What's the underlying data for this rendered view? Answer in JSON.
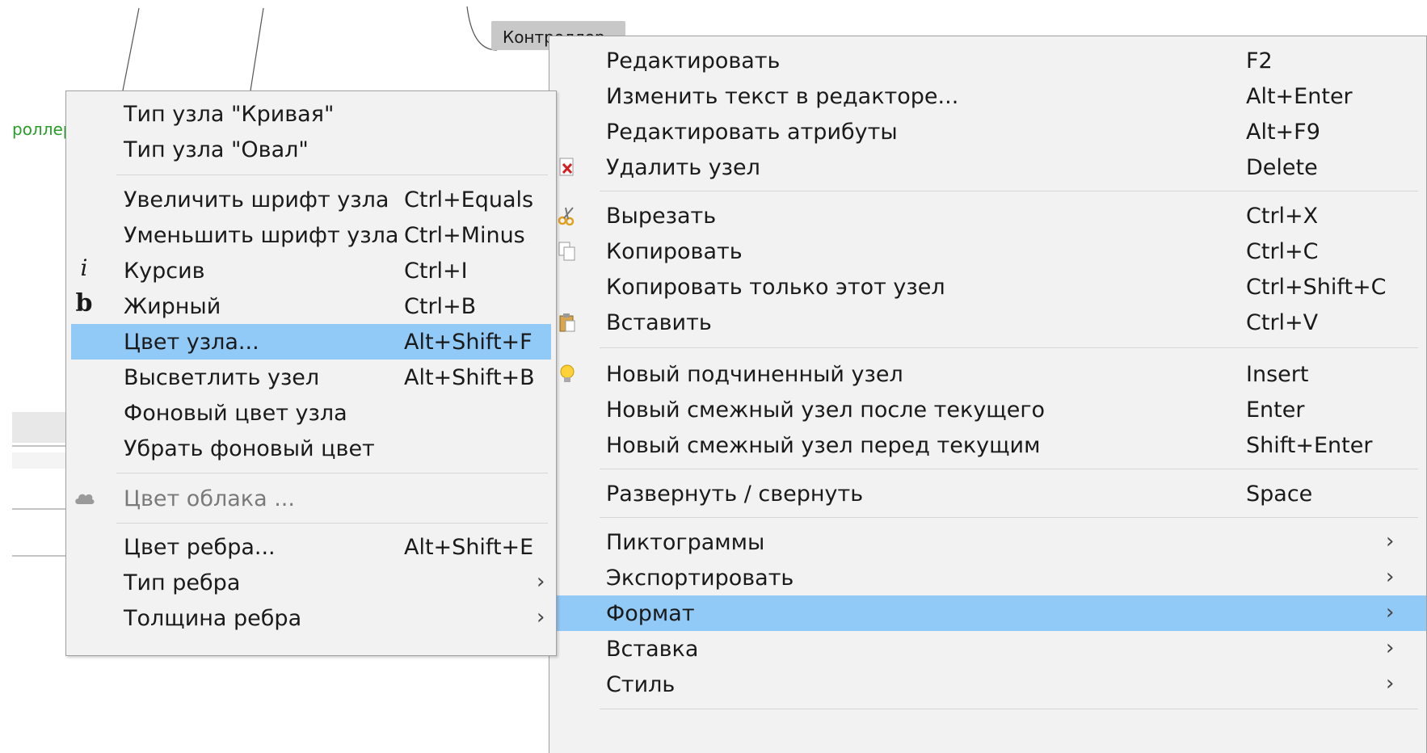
{
  "background": {
    "node_label": "Контроллер",
    "side_node_label": "роллер"
  },
  "main_menu": {
    "items": [
      {
        "label": "Редактировать",
        "shortcut": "F2"
      },
      {
        "label": "Изменить текст в редакторе...",
        "shortcut": "Alt+Enter"
      },
      {
        "label": "Редактировать атрибуты",
        "shortcut": "Alt+F9"
      },
      {
        "label": "Удалить узел",
        "shortcut": "Delete",
        "icon": "delete-icon"
      },
      {
        "label": "Вырезать",
        "shortcut": "Ctrl+X",
        "icon": "scissors-icon"
      },
      {
        "label": "Копировать",
        "shortcut": "Ctrl+C",
        "icon": "copy-icon"
      },
      {
        "label": "Копировать только этот узел",
        "shortcut": "Ctrl+Shift+C"
      },
      {
        "label": "Вставить",
        "shortcut": "Ctrl+V",
        "icon": "paste-icon"
      },
      {
        "label": "Новый подчиненный узел",
        "shortcut": "Insert",
        "icon": "lightbulb-icon"
      },
      {
        "label": "Новый смежный узел после текущего",
        "shortcut": "Enter"
      },
      {
        "label": "Новый смежный узел перед текущим",
        "shortcut": "Shift+Enter"
      },
      {
        "label": "Развернуть / свернуть",
        "shortcut": "Space"
      },
      {
        "label": "Пиктограммы",
        "submenu": true
      },
      {
        "label": "Экспортировать",
        "submenu": true
      },
      {
        "label": "Формат",
        "submenu": true,
        "highlighted": true
      },
      {
        "label": "Вставка",
        "submenu": true
      },
      {
        "label": "Стиль",
        "submenu": true
      }
    ]
  },
  "format_menu": {
    "items": [
      {
        "label": "Тип узла \"Кривая\""
      },
      {
        "label": "Тип узла \"Овал\""
      },
      {
        "label": "Увеличить шрифт узла",
        "shortcut": "Ctrl+Equals"
      },
      {
        "label": "Уменьшить шрифт узла",
        "shortcut": "Ctrl+Minus"
      },
      {
        "label": "Курсив",
        "shortcut": "Ctrl+I",
        "icon": "italic-icon",
        "icon_glyph": "i"
      },
      {
        "label": "Жирный",
        "shortcut": "Ctrl+B",
        "icon": "bold-icon",
        "icon_glyph": "b"
      },
      {
        "label": "Цвет узла...",
        "shortcut": "Alt+Shift+F",
        "highlighted": true
      },
      {
        "label": "Высветлить узел",
        "shortcut": "Alt+Shift+B"
      },
      {
        "label": "Фоновый цвет узла"
      },
      {
        "label": "Убрать фоновый цвет"
      },
      {
        "label": "Цвет облака ...",
        "disabled": true,
        "icon": "cloud-icon"
      },
      {
        "label": "Цвет ребра...",
        "shortcut": "Alt+Shift+E"
      },
      {
        "label": "Тип ребра",
        "submenu": true
      },
      {
        "label": "Толщина ребра",
        "submenu": true
      }
    ]
  },
  "arrow_glyph": "›",
  "colors": {
    "highlight": "#91c9f7",
    "menu_bg": "#f2f2f2",
    "green_node": "#2a9d2a"
  }
}
